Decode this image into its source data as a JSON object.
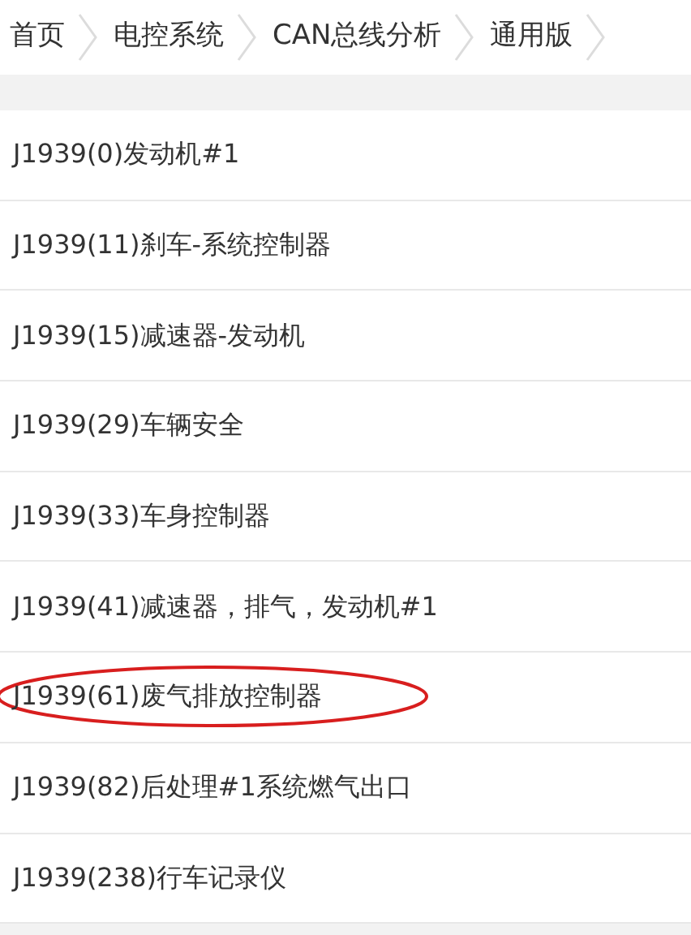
{
  "breadcrumb": [
    "首页",
    "电控系统",
    "CAN总线分析",
    "通用版"
  ],
  "items": [
    {
      "label": "J1939(0)发动机#1",
      "highlighted": false
    },
    {
      "label": "J1939(11)刹车-系统控制器",
      "highlighted": false
    },
    {
      "label": "J1939(15)减速器-发动机",
      "highlighted": false
    },
    {
      "label": "J1939(29)车辆安全",
      "highlighted": false
    },
    {
      "label": "J1939(33)车身控制器",
      "highlighted": false
    },
    {
      "label": "J1939(41)减速器，排气，发动机#1",
      "highlighted": false
    },
    {
      "label": "J1939(61)废气排放控制器",
      "highlighted": true
    },
    {
      "label": "J1939(82)后处理#1系统燃气出口",
      "highlighted": false
    },
    {
      "label": "J1939(238)行车记录仪",
      "highlighted": false
    }
  ]
}
